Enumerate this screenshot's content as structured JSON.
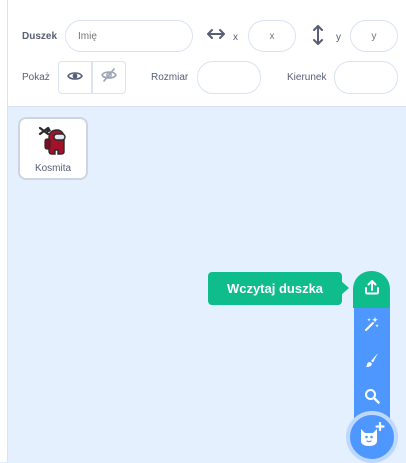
{
  "sprite_info": {
    "sprite_label": "Duszek",
    "name_placeholder": "Imię",
    "x_label": "x",
    "x_placeholder": "x",
    "y_label": "y",
    "y_placeholder": "y",
    "show_label": "Pokaż",
    "size_label": "Rozmiar",
    "size_value": "",
    "direction_label": "Kierunek",
    "direction_value": ""
  },
  "sprites": [
    {
      "name": "Kosmita"
    }
  ],
  "sprite_menu": {
    "tooltip": "Wczytaj duszka",
    "items": [
      "upload-icon",
      "surprise-icon",
      "paint-icon",
      "search-icon"
    ],
    "main_icon": "cat-plus-icon"
  },
  "colors": {
    "accent": "#4d97ff",
    "upload_green": "#0fbd8c",
    "text": "#575e75",
    "pane_bg": "#e5f0ff"
  }
}
